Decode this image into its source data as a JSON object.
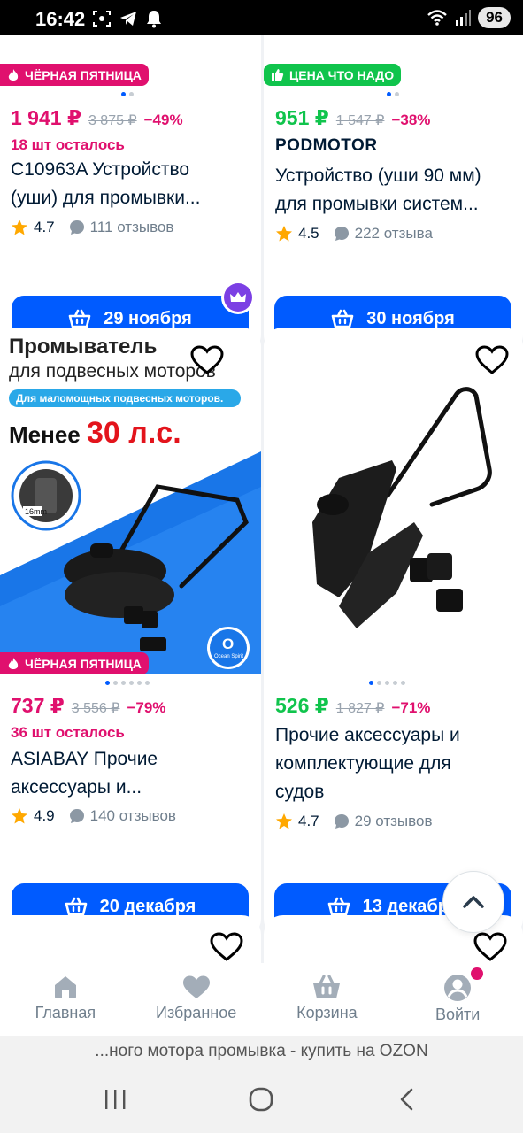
{
  "status": {
    "time": "16:42",
    "battery": "96",
    "icons": [
      "screenshot-icon",
      "telegram-icon",
      "bell-icon",
      "wifi-icon",
      "signal-icon"
    ]
  },
  "cards": [
    {
      "badge": "ЧЁРНАЯ ПЯТНИЦА",
      "price": "1 941 ₽",
      "old_price": "3 875 ₽",
      "discount": "−49%",
      "stock": "18 шт осталось",
      "title_line1": "C10963A Устройство",
      "title_line2": "(уши) для промывки...",
      "rating": "4.7",
      "reviews": "111 отзывов",
      "delivery": "29 ноября"
    },
    {
      "badge": "ЦЕНА ЧТО НАДО",
      "price": "951 ₽",
      "old_price": "1 547 ₽",
      "discount": "−38%",
      "brand": "PODMOTOR",
      "title_line1": "Устройство (уши 90 мм)",
      "title_line2": "для промывки систем...",
      "rating": "4.5",
      "reviews": "222 отзыва",
      "delivery": "30 ноября"
    },
    {
      "promo_title": "Промыватель",
      "promo_subtitle": "для подвесных моторов",
      "promo_note": "Для маломощных подвесных моторов.",
      "promo_power_prefix": "Менее",
      "promo_power": "30 л.с.",
      "promo_size": "16mm",
      "promo_logo_letter": "O",
      "promo_logo_text": "Ocean Spirit",
      "badge": "ЧЁРНАЯ ПЯТНИЦА",
      "price": "737 ₽",
      "old_price": "3 556 ₽",
      "discount": "−79%",
      "stock": "36 шт осталось",
      "title_line1": "ASIABAY Прочие",
      "title_line2": "аксессуары и...",
      "rating": "4.9",
      "reviews": "140 отзывов",
      "delivery": "20 декабря"
    },
    {
      "price": "526 ₽",
      "old_price": "1 827 ₽",
      "discount": "−71%",
      "title_line1": "Прочие аксессуары и",
      "title_line2": "комплектующие для",
      "title_line3": "судов",
      "rating": "4.7",
      "reviews": "29 отзывов",
      "delivery": "13 декабря"
    }
  ],
  "nav": [
    {
      "label": "Главная",
      "icon": "home-icon"
    },
    {
      "label": "Избранное",
      "icon": "heart-icon"
    },
    {
      "label": "Корзина",
      "icon": "cart-icon"
    },
    {
      "label": "Войти",
      "icon": "profile-icon"
    }
  ],
  "url_text": "...ного мотора промывка - купить на OZON",
  "colors": {
    "accent": "#005bff",
    "sale_pink": "#e0106e",
    "good_price_green": "#10c44c",
    "background": "#f0f2f5"
  }
}
